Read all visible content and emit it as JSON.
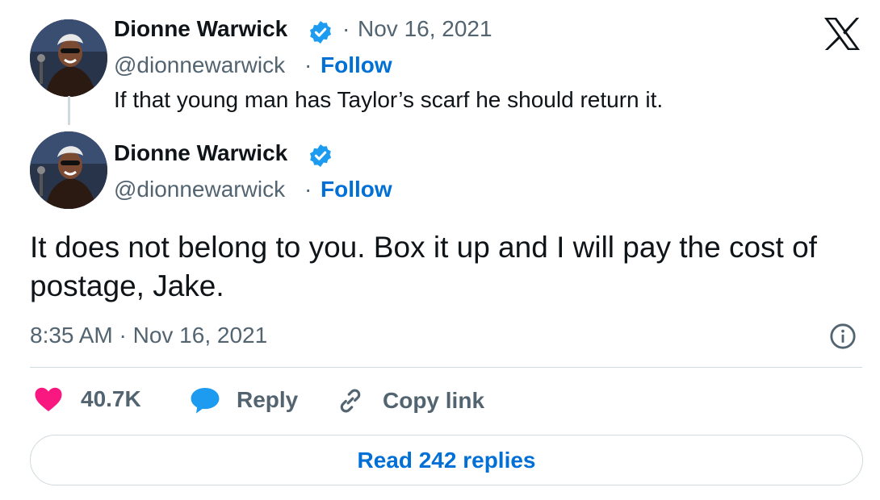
{
  "parent_tweet": {
    "display_name": "Dionne Warwick",
    "separator": "·",
    "date": "Nov 16, 2021",
    "handle": "@dionnewarwick",
    "follow_label": "Follow",
    "text": "If that young man has Taylor’s scarf he should return it."
  },
  "main_tweet": {
    "display_name": "Dionne Warwick",
    "handle": "@dionnewarwick",
    "separator": "·",
    "follow_label": "Follow",
    "text": "It does not belong to you. Box it up and I will pay the cost of postage, Jake.",
    "timestamp": "8:35 AM · Nov 16, 2021"
  },
  "actions": {
    "like_count": "40.7K",
    "reply_label": "Reply",
    "copy_link_label": "Copy link"
  },
  "read_replies_label": "Read 242 replies",
  "icons": {
    "brand": "x-logo-icon",
    "verified": "verified-badge-icon",
    "info": "info-icon",
    "like": "heart-icon",
    "reply": "speech-bubble-icon",
    "copy": "link-icon"
  },
  "colors": {
    "accent": "#1d9bf0",
    "link": "#006fd6",
    "like": "#f91880",
    "muted": "#536471",
    "text": "#0f1419"
  }
}
